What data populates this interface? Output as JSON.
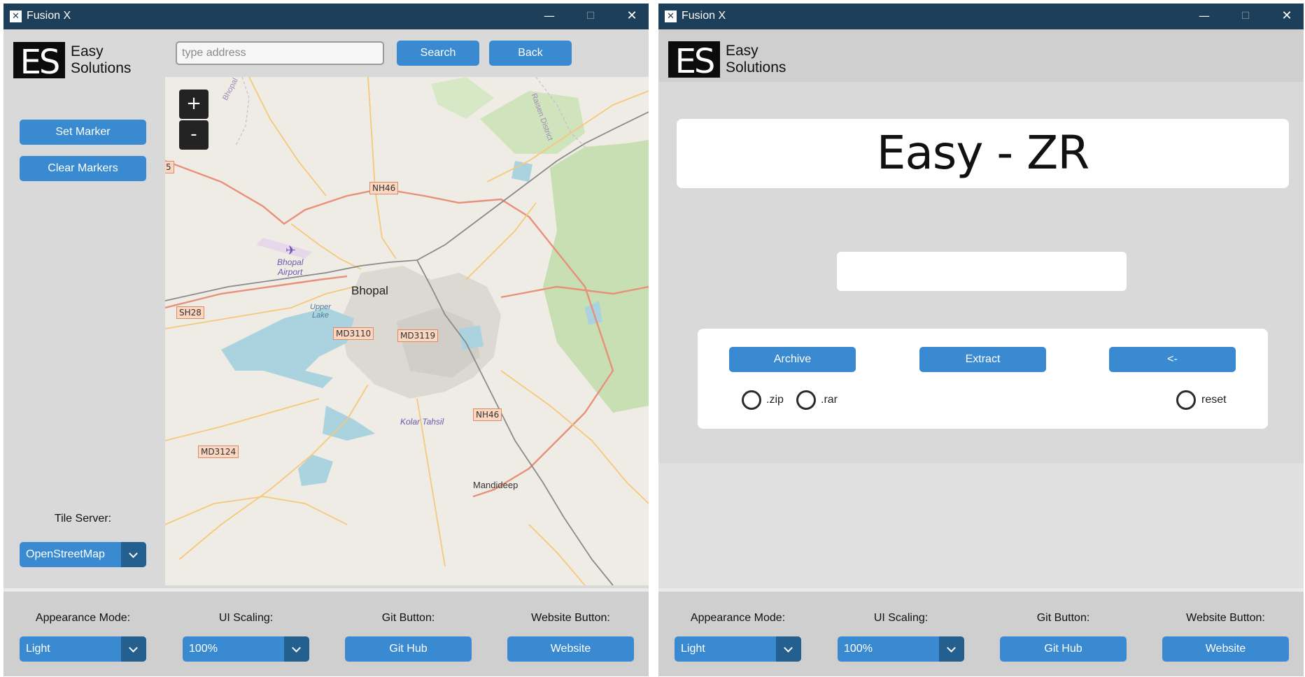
{
  "window_left": {
    "title": "Fusion X",
    "controls": {
      "minimize": "—",
      "maximize": "☐",
      "close": "✕"
    },
    "logo": {
      "mark": "ES",
      "line1": "Easy",
      "line2": "Solutions"
    },
    "search": {
      "placeholder": "type address",
      "value": ""
    },
    "buttons": {
      "search": "Search",
      "back": "Back",
      "set_marker": "Set Marker",
      "clear_markers": "Clear Markers"
    },
    "tile_server": {
      "label": "Tile Server:",
      "selected": "OpenStreetMap"
    },
    "map": {
      "zoom_in": "+",
      "zoom_out": "-",
      "labels": {
        "city": "Bhopal",
        "airport_line1": "Bhopal",
        "airport_line2": "Airport",
        "lake_line1": "Upper",
        "lake_line2": "Lake",
        "tehsil": "Kolar Tahsil",
        "town": "Mandideep",
        "district_nw": "Bhopal District",
        "district_ne": "Raisen District"
      },
      "shields": {
        "nh46_top": "NH46",
        "nh46_bottom": "NH46",
        "sh28": "SH28",
        "md3110": "MD3110",
        "md3119": "MD3119",
        "md3124": "MD3124",
        "edge_5": "5"
      }
    },
    "bottom": {
      "appearance_label": "Appearance Mode:",
      "appearance_value": "Light",
      "scaling_label": "UI Scaling:",
      "scaling_value": "100%",
      "git_label": "Git Button:",
      "git_button": "Git Hub",
      "website_label": "Website Button:",
      "website_button": "Website"
    }
  },
  "window_right": {
    "title": "Fusion X",
    "controls": {
      "minimize": "—",
      "maximize": "☐",
      "close": "✕"
    },
    "logo": {
      "mark": "ES",
      "line1": "Easy",
      "line2": "Solutions"
    },
    "app_title": "Easy - ZR",
    "entry": {
      "value": ""
    },
    "buttons": {
      "archive": "Archive",
      "extract": "Extract",
      "back": "<-"
    },
    "radios": {
      "zip": ".zip",
      "rar": ".rar",
      "reset": "reset"
    },
    "bottom": {
      "appearance_label": "Appearance Mode:",
      "appearance_value": "Light",
      "scaling_label": "UI Scaling:",
      "scaling_value": "100%",
      "git_label": "Git Button:",
      "git_button": "Git Hub",
      "website_label": "Website Button:",
      "website_button": "Website"
    }
  },
  "colors": {
    "titlebar": "#1d3f5a",
    "accent": "#3a8ad1",
    "accent_dark": "#235f8f",
    "panel_bg": "#d9d9d9"
  }
}
